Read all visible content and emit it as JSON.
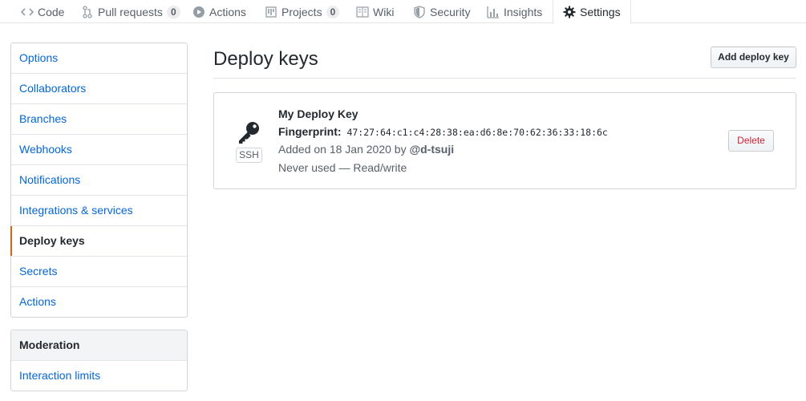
{
  "tabs": [
    {
      "label": "Code"
    },
    {
      "label": "Pull requests",
      "count": "0"
    },
    {
      "label": "Actions"
    },
    {
      "label": "Projects",
      "count": "0"
    },
    {
      "label": "Wiki"
    },
    {
      "label": "Security"
    },
    {
      "label": "Insights"
    },
    {
      "label": "Settings"
    }
  ],
  "sidebar": {
    "items": [
      {
        "label": "Options"
      },
      {
        "label": "Collaborators"
      },
      {
        "label": "Branches"
      },
      {
        "label": "Webhooks"
      },
      {
        "label": "Notifications"
      },
      {
        "label": "Integrations & services"
      },
      {
        "label": "Deploy keys"
      },
      {
        "label": "Secrets"
      },
      {
        "label": "Actions"
      }
    ],
    "moderation": {
      "heading": "Moderation",
      "items": [
        {
          "label": "Interaction limits"
        }
      ]
    }
  },
  "main": {
    "title": "Deploy keys",
    "add_button": "Add deploy key",
    "key": {
      "type": "SSH",
      "name": "My Deploy Key",
      "fingerprint_label": "Fingerprint:",
      "fingerprint": "47:27:64:c1:c4:28:38:ea:d6:8e:70:62:36:33:18:6c",
      "added_prefix": "Added on 18 Jan 2020 by",
      "added_by": "@d-tsuji",
      "usage": "Never used — Read/write",
      "delete_button": "Delete"
    }
  },
  "colors": {
    "link": "#0366d6",
    "accent": "#e36209",
    "danger": "#cb2431"
  }
}
